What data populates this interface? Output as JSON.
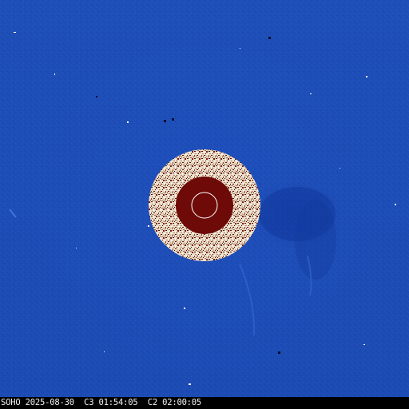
{
  "image": {
    "footer": {
      "observatory": "SOHO",
      "date": "2025-08-30",
      "c3_label": "C3",
      "c3_time": "01:54:05",
      "c2_label": "C2",
      "c2_time": "02:00:05"
    },
    "colors": {
      "sky": "#1e4fb8",
      "occulter_ring": "#f5ece0",
      "occulter_disk": "#6e0a08",
      "sun_outline": "#ffffff",
      "footer_bg": "#000000",
      "footer_text": "#f0f0f0"
    }
  }
}
